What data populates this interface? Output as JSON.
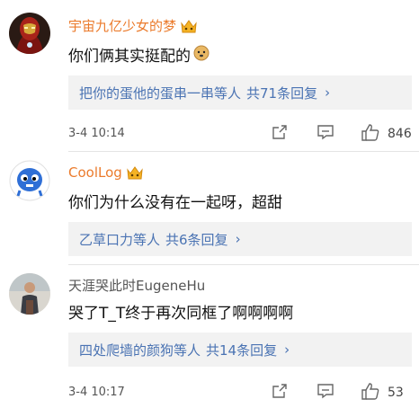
{
  "comments": [
    {
      "username": "宇宙九亿少女的梦",
      "username_color": "#eb7b2c",
      "has_vip_badge": true,
      "text": "你们俩其实挺配的",
      "text_emoji": "doge-emoji",
      "reply_box": {
        "names": "把你的蛋他的蛋串一串等人",
        "count": "共71条回复",
        "chevron": "›"
      },
      "timestamp": "3-4 10:14",
      "likes": "846"
    },
    {
      "username": "CoolLog",
      "username_color": "#eb7b2c",
      "has_vip_badge": true,
      "text": "你们为什么没有在一起呀，超甜",
      "reply_box": {
        "names": "乙草口力等人",
        "count": "共6条回复",
        "chevron": "›"
      }
    },
    {
      "username": "天涯哭此时EugeneHu",
      "username_color": "#555555",
      "has_vip_badge": false,
      "text": "哭了T_T终于再次同框了啊啊啊啊",
      "reply_box": {
        "names": "四处爬墙的颜狗等人",
        "count": "共14条回复",
        "chevron": "›"
      },
      "timestamp": "3-4 10:17",
      "likes": "53"
    }
  ],
  "icons": {
    "share": "share-icon",
    "reply": "comment-icon",
    "like": "thumbs-up-icon"
  },
  "colors": {
    "accent_link": "#4a73b3",
    "username_orange": "#eb7b2c",
    "reply_bg": "#f2f2f2"
  }
}
